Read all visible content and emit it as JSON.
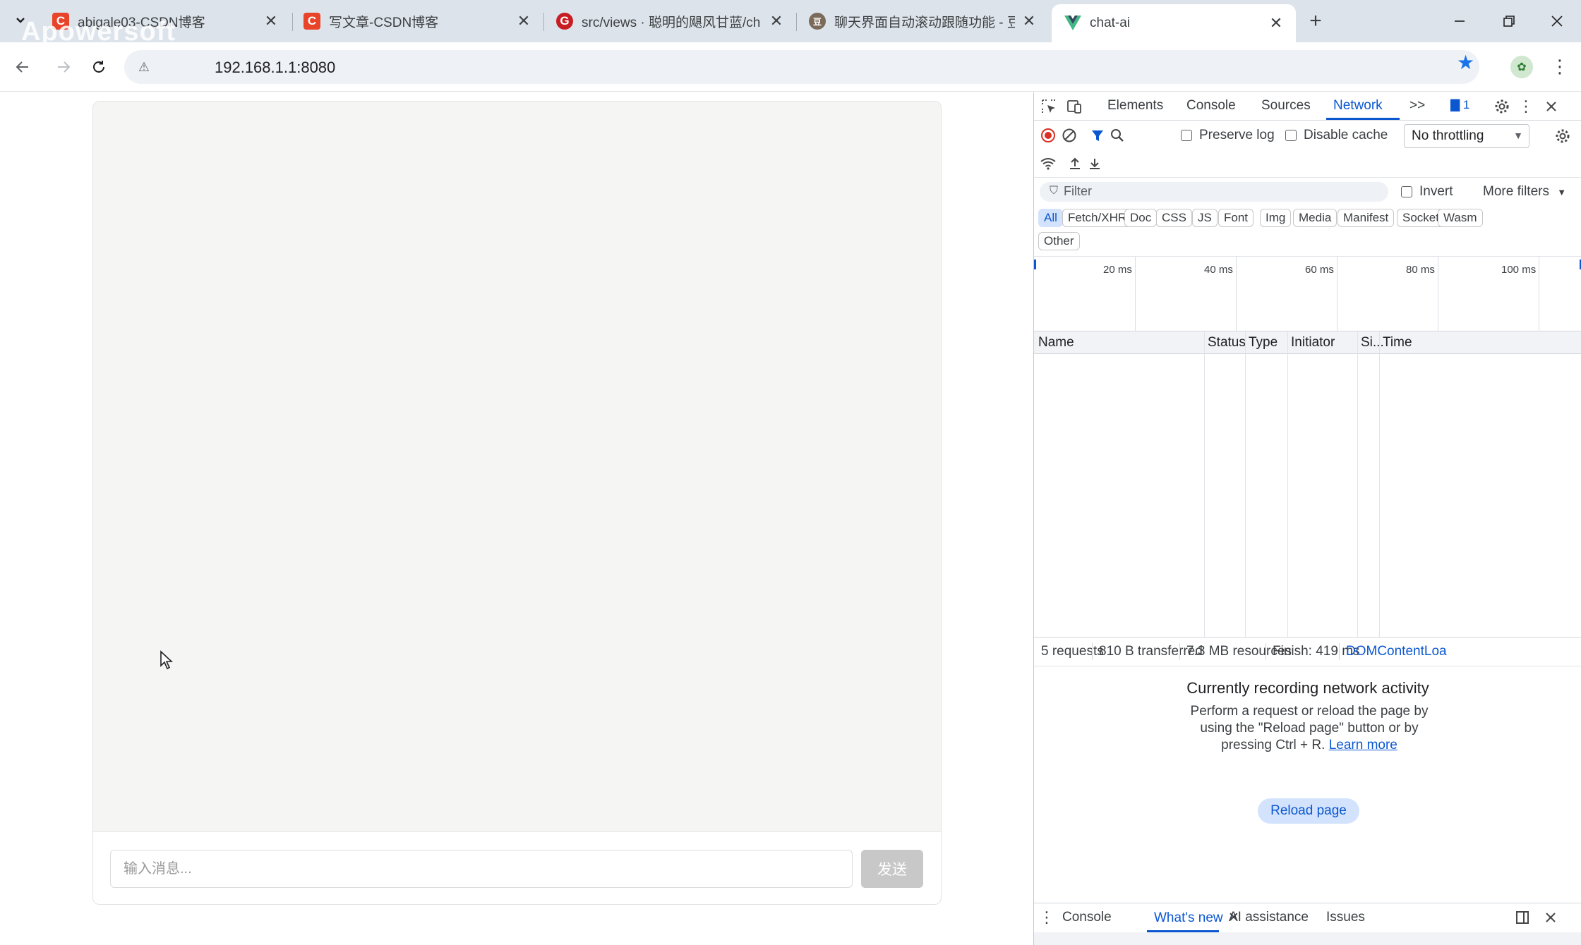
{
  "watermark": "Apowersoft",
  "browser": {
    "tabs": [
      {
        "title": "abigale03-CSDN博客",
        "favicon": "C"
      },
      {
        "title": "写文章-CSDN博客",
        "favicon": "C"
      },
      {
        "title": "src/views · 聪明的飓风甘蓝/ch",
        "favicon": "G"
      },
      {
        "title": "聊天界面自动滚动跟随功能 - 豆",
        "favicon": "豆"
      },
      {
        "title": "chat-ai",
        "favicon": "V"
      }
    ],
    "url": "192.168.1.1:8080",
    "new_tab": "+",
    "colors": {
      "csdn": "#e8442a",
      "gitee": "#c71d23",
      "vue": "#41b883",
      "accent": "#1a73e8"
    }
  },
  "chat": {
    "input_placeholder": "输入消息...",
    "send_label": "发送"
  },
  "devtools": {
    "tabs": [
      "Elements",
      "Console",
      "Sources",
      "Network"
    ],
    "more_tabs": ">>",
    "issues_count": "1",
    "preserve_log": "Preserve log",
    "disable_cache": "Disable cache",
    "throttling": "No throttling",
    "filter_placeholder": "Filter",
    "invert": "Invert",
    "more_filters": "More filters",
    "type_filters": [
      "All",
      "Fetch/XHR",
      "Doc",
      "CSS",
      "JS",
      "Font",
      "Img",
      "Media",
      "Manifest",
      "Socket",
      "Wasm",
      "Other"
    ],
    "timeline_ticks": [
      "20 ms",
      "40 ms",
      "60 ms",
      "80 ms",
      "100 ms"
    ],
    "columns": [
      "Name",
      "Status",
      "Type",
      "Initiator",
      "Si...",
      "Time"
    ],
    "summary": {
      "requests": "5 requests",
      "transferred": "810 B transferred",
      "resources": "7.3 MB resources",
      "finish": "Finish: 419 ms",
      "dom": "DOMContentLoa"
    },
    "empty": {
      "title": "Currently recording network activity",
      "line1": "Perform a request or reload the page by",
      "line2": "using the \"Reload page\" button or by",
      "line3": "pressing Ctrl + R.",
      "link": "Learn more",
      "button": "Reload page"
    },
    "drawer_tabs": [
      "Console",
      "What's new",
      "AI assistance",
      "Issues"
    ]
  }
}
